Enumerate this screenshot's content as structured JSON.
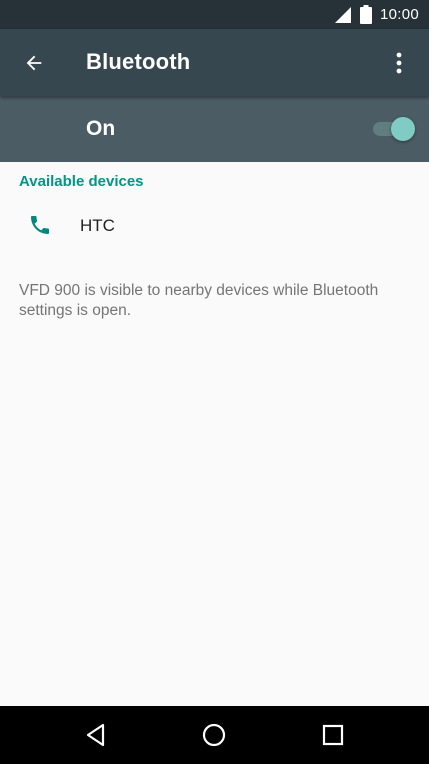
{
  "status_bar": {
    "time": "10:00",
    "icons": [
      "signal-icon",
      "battery-icon"
    ]
  },
  "app_bar": {
    "title": "Bluetooth",
    "back_icon": "arrow-back-icon",
    "menu_icon": "more-vertical-icon"
  },
  "master_switch": {
    "label": "On",
    "state": "on"
  },
  "available_devices": {
    "header": "Available devices",
    "items": [
      {
        "name": "HTC",
        "icon": "phone-icon"
      }
    ]
  },
  "visibility_note": "VFD 900 is visible to nearby devices while Bluetooth settings is open.",
  "nav_bar": {
    "buttons": [
      "nav-back-icon",
      "nav-home-icon",
      "nav-recents-icon"
    ]
  },
  "colors": {
    "status_bar": "#263238",
    "app_bar": "#37474f",
    "switch_bar": "#4b5c64",
    "accent": "#009688",
    "toggle_thumb": "#80cbc4",
    "background": "#fafafa"
  }
}
